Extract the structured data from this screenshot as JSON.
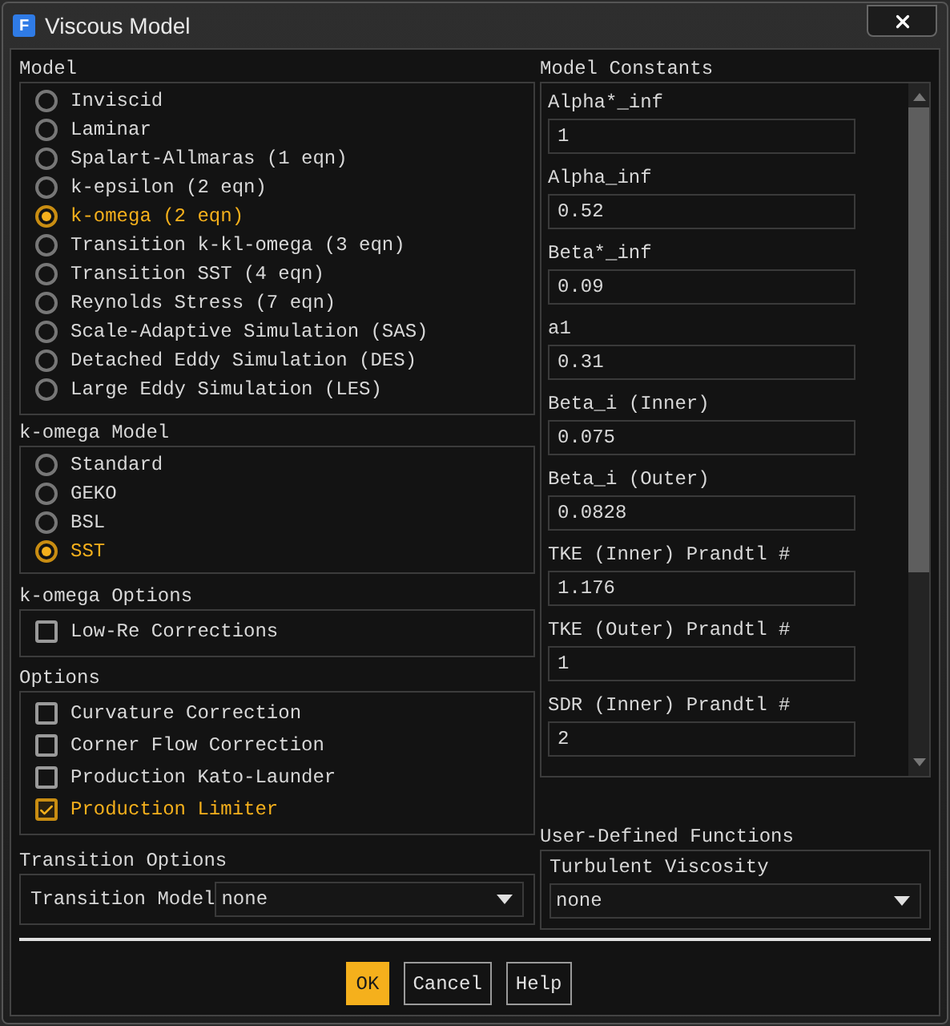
{
  "window": {
    "icon_letter": "F",
    "title": "Viscous Model"
  },
  "model": {
    "label": "Model",
    "options": [
      {
        "label": "Inviscid",
        "selected": false
      },
      {
        "label": "Laminar",
        "selected": false
      },
      {
        "label": "Spalart-Allmaras (1 eqn)",
        "selected": false
      },
      {
        "label": "k-epsilon (2 eqn)",
        "selected": false
      },
      {
        "label": "k-omega (2 eqn)",
        "selected": true
      },
      {
        "label": "Transition k-kl-omega (3 eqn)",
        "selected": false
      },
      {
        "label": "Transition SST (4 eqn)",
        "selected": false
      },
      {
        "label": "Reynolds Stress (7 eqn)",
        "selected": false
      },
      {
        "label": "Scale-Adaptive Simulation (SAS)",
        "selected": false
      },
      {
        "label": "Detached Eddy Simulation (DES)",
        "selected": false
      },
      {
        "label": "Large Eddy Simulation (LES)",
        "selected": false
      }
    ]
  },
  "komega_model": {
    "label": "k-omega Model",
    "options": [
      {
        "label": "Standard",
        "selected": false
      },
      {
        "label": "GEKO",
        "selected": false
      },
      {
        "label": "BSL",
        "selected": false
      },
      {
        "label": "SST",
        "selected": true
      }
    ]
  },
  "komega_options": {
    "label": "k-omega Options",
    "items": [
      {
        "label": "Low-Re Corrections",
        "checked": false
      }
    ]
  },
  "options": {
    "label": "Options",
    "items": [
      {
        "label": "Curvature Correction",
        "checked": false
      },
      {
        "label": "Corner Flow Correction",
        "checked": false
      },
      {
        "label": "Production Kato-Launder",
        "checked": false
      },
      {
        "label": "Production Limiter",
        "checked": true
      }
    ]
  },
  "transition_options": {
    "label": "Transition Options",
    "field_label": "Transition Model",
    "value": "none"
  },
  "model_constants": {
    "label": "Model Constants",
    "items": [
      {
        "label": "Alpha*_inf",
        "value": "1"
      },
      {
        "label": "Alpha_inf",
        "value": "0.52"
      },
      {
        "label": "Beta*_inf",
        "value": "0.09"
      },
      {
        "label": "a1",
        "value": "0.31"
      },
      {
        "label": "Beta_i (Inner)",
        "value": "0.075"
      },
      {
        "label": "Beta_i (Outer)",
        "value": "0.0828"
      },
      {
        "label": "TKE (Inner) Prandtl #",
        "value": "1.176"
      },
      {
        "label": "TKE (Outer) Prandtl #",
        "value": "1"
      },
      {
        "label": "SDR (Inner) Prandtl #",
        "value": "2"
      }
    ]
  },
  "udf": {
    "label": "User-Defined Functions",
    "field_label": "Turbulent Viscosity",
    "value": "none"
  },
  "buttons": [
    {
      "label": "OK",
      "kind": "primary"
    },
    {
      "label": "Cancel",
      "kind": "normal"
    },
    {
      "label": "Help",
      "kind": "normal"
    }
  ]
}
